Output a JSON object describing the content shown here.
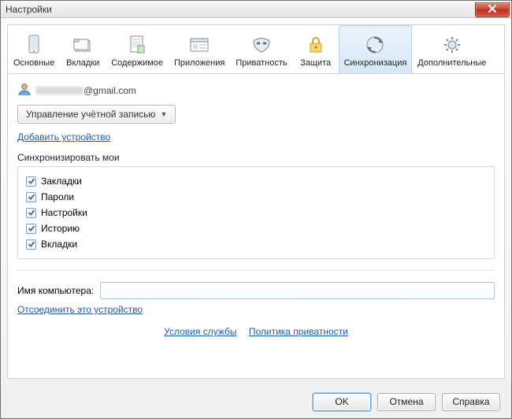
{
  "window_title": "Настройки",
  "tabs": [
    {
      "label": "Основные"
    },
    {
      "label": "Вкладки"
    },
    {
      "label": "Содержимое"
    },
    {
      "label": "Приложения"
    },
    {
      "label": "Приватность"
    },
    {
      "label": "Защита"
    },
    {
      "label": "Синхронизация"
    },
    {
      "label": "Дополнительные"
    }
  ],
  "account": {
    "email_visible_part": "@gmail.com",
    "manage_button": "Управление учётной записью",
    "add_device_link": "Добавить устройство"
  },
  "sync": {
    "section_label": "Синхронизировать мои",
    "items": [
      {
        "label": "Закладки",
        "checked": true
      },
      {
        "label": "Пароли",
        "checked": true
      },
      {
        "label": "Настройки",
        "checked": true
      },
      {
        "label": "Историю",
        "checked": true
      },
      {
        "label": "Вкладки",
        "checked": true
      }
    ]
  },
  "computer": {
    "label": "Имя компьютера:",
    "value": "",
    "disconnect_link": "Отсоединить это устройство"
  },
  "legal": {
    "terms": "Условия службы",
    "privacy": "Политика приватности"
  },
  "buttons": {
    "ok": "OK",
    "cancel": "Отмена",
    "help": "Справка"
  }
}
